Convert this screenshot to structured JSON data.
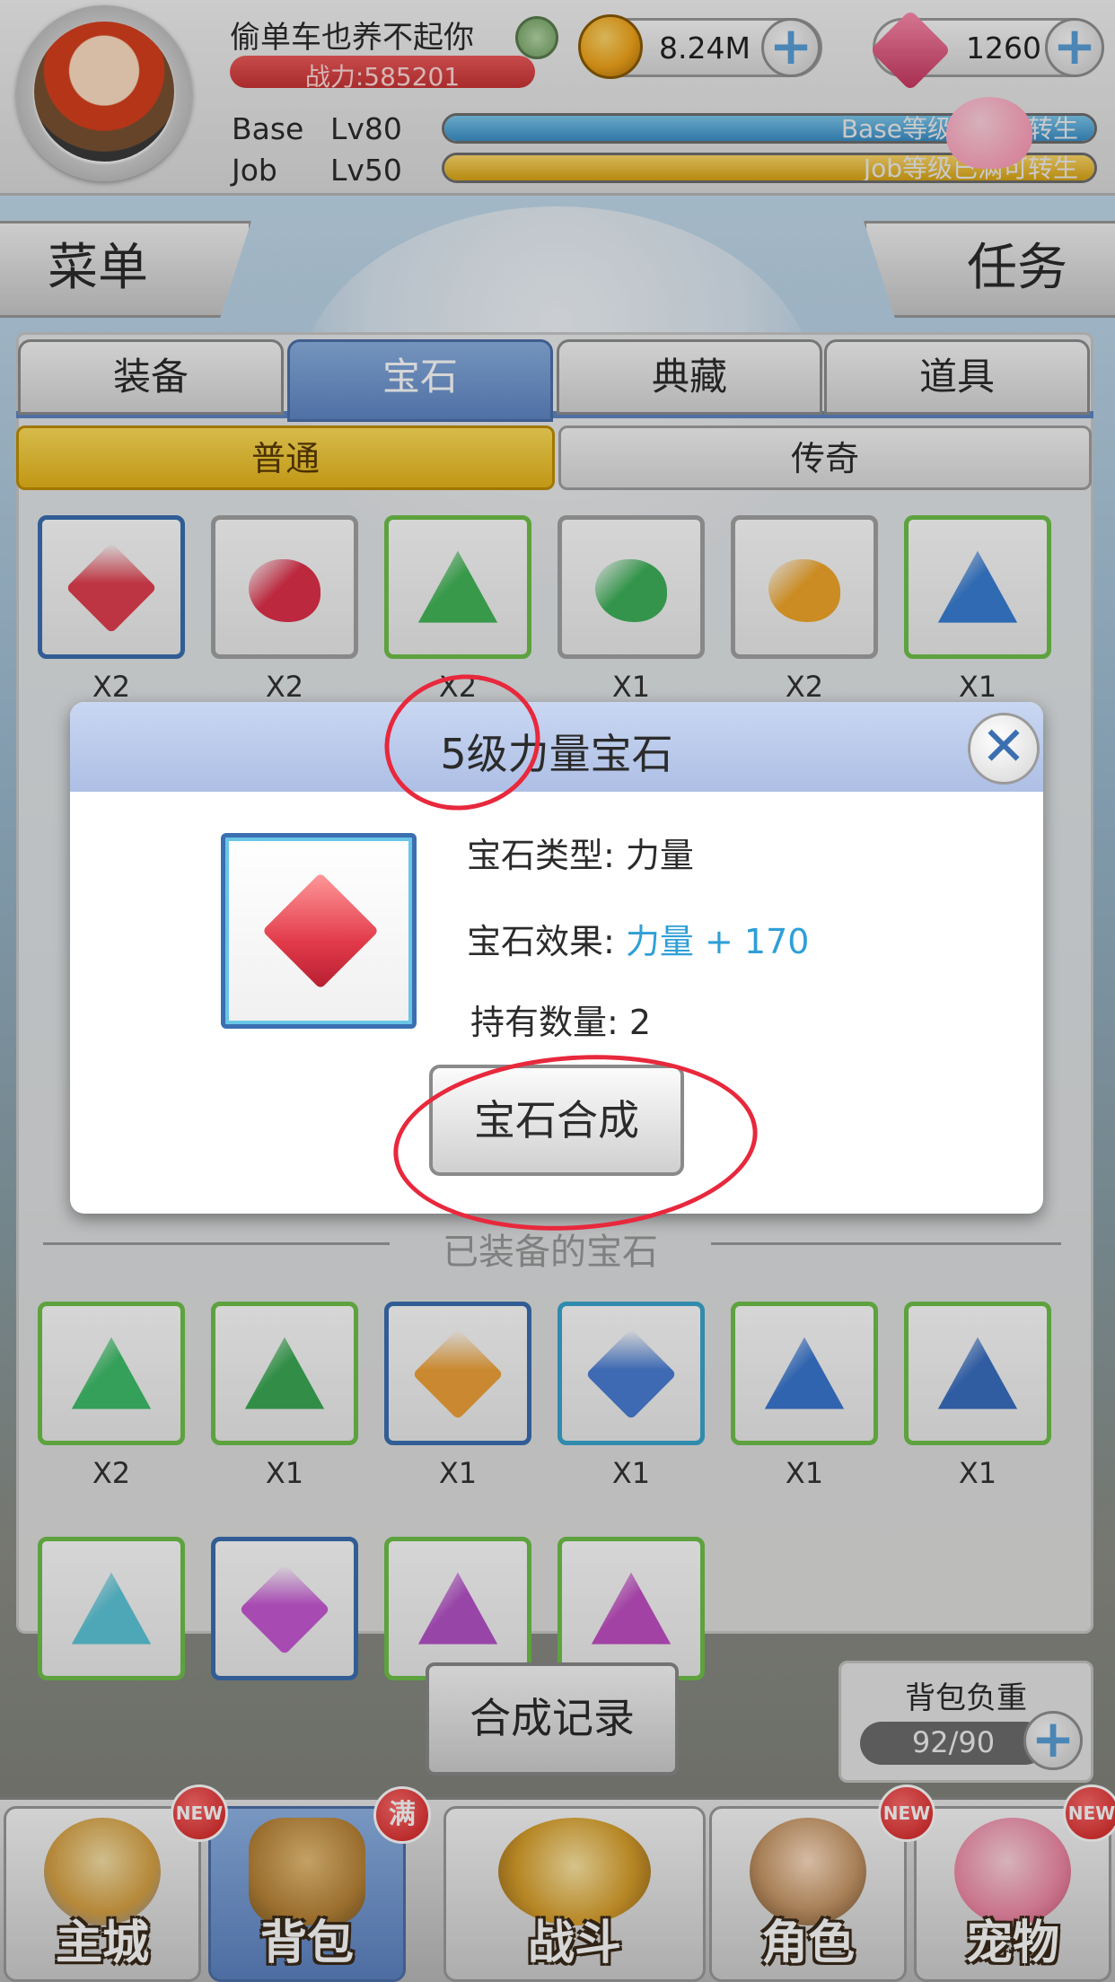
{
  "player": {
    "name": "偷单车也养不起你",
    "power": "战力:585201",
    "base_label": "Base",
    "base_level": "Lv80",
    "base_status": "Base等级已满可转生",
    "base_fill": 1.0,
    "job_label": "Job",
    "job_level": "Lv50",
    "job_status": "Job等级已满可转生",
    "job_fill": 1.0
  },
  "currency": {
    "coins": "8.24M",
    "gems": "1260"
  },
  "side_buttons": {
    "menu": "菜单",
    "task": "任务"
  },
  "tabs": [
    {
      "label": "装备"
    },
    {
      "label": "宝石"
    },
    {
      "label": "典藏"
    },
    {
      "label": "道具"
    }
  ],
  "subtabs": [
    {
      "label": "普通"
    },
    {
      "label": "传奇"
    }
  ],
  "inventory_gems": [
    {
      "qty": "X2",
      "border": "blue",
      "color": "#e2404f",
      "shape": "diamond"
    },
    {
      "qty": "X2",
      "border": "gray",
      "color": "#e0304a",
      "shape": "round"
    },
    {
      "qty": "X2",
      "border": "green",
      "color": "#45b75a",
      "shape": "tri"
    },
    {
      "qty": "X1",
      "border": "gray",
      "color": "#3fb15a",
      "shape": "round"
    },
    {
      "qty": "X2",
      "border": "gray",
      "color": "#f2a72b",
      "shape": "round"
    },
    {
      "qty": "X1",
      "border": "green",
      "color": "#3a7fd4",
      "shape": "tri"
    }
  ],
  "equipped_title": "已装备的宝石",
  "equipped_gems": [
    {
      "qty": "X2",
      "border": "green",
      "color": "#3fbf6a",
      "shape": "tri"
    },
    {
      "qty": "X1",
      "border": "green",
      "color": "#3caa55",
      "shape": "tri"
    },
    {
      "qty": "X1",
      "border": "blue",
      "color": "#f1a43a",
      "shape": "diamond"
    },
    {
      "qty": "X1",
      "border": "cyan",
      "color": "#4b7fd6",
      "shape": "diamond"
    },
    {
      "qty": "X1",
      "border": "green",
      "color": "#3b78d1",
      "shape": "tri"
    },
    {
      "qty": "X1",
      "border": "green",
      "color": "#3a6fc2",
      "shape": "tri"
    },
    {
      "qty": "",
      "border": "green",
      "color": "#5ec7d9",
      "shape": "tri"
    },
    {
      "qty": "",
      "border": "blue",
      "color": "#c85ad6",
      "shape": "diamond"
    },
    {
      "qty": "",
      "border": "green",
      "color": "#b653c9",
      "shape": "tri"
    },
    {
      "qty": "",
      "border": "green",
      "color": "#c24fc4",
      "shape": "tri"
    }
  ],
  "dialog": {
    "title": "5级力量宝石",
    "type_label": "宝石类型:",
    "type_value": "力量",
    "effect_label": "宝石效果:",
    "effect_value": "力量 + 170",
    "count_label": "持有数量:",
    "count_value": "2",
    "compose_button": "宝石合成"
  },
  "bottom": {
    "record_button": "合成记录",
    "bag_label": "背包负重",
    "bag_value": "92/90"
  },
  "nav": [
    {
      "label": "主城",
      "badge": "NEW"
    },
    {
      "label": "背包",
      "badge": "满"
    },
    {
      "label": "战斗",
      "badge": ""
    },
    {
      "label": "角色",
      "badge": "NEW"
    },
    {
      "label": "宠物",
      "badge": "NEW"
    }
  ],
  "colors": {
    "accent_blue": "#5f86c4",
    "highlight": "#2f9fd6",
    "annotation_red": "#e8283c"
  }
}
